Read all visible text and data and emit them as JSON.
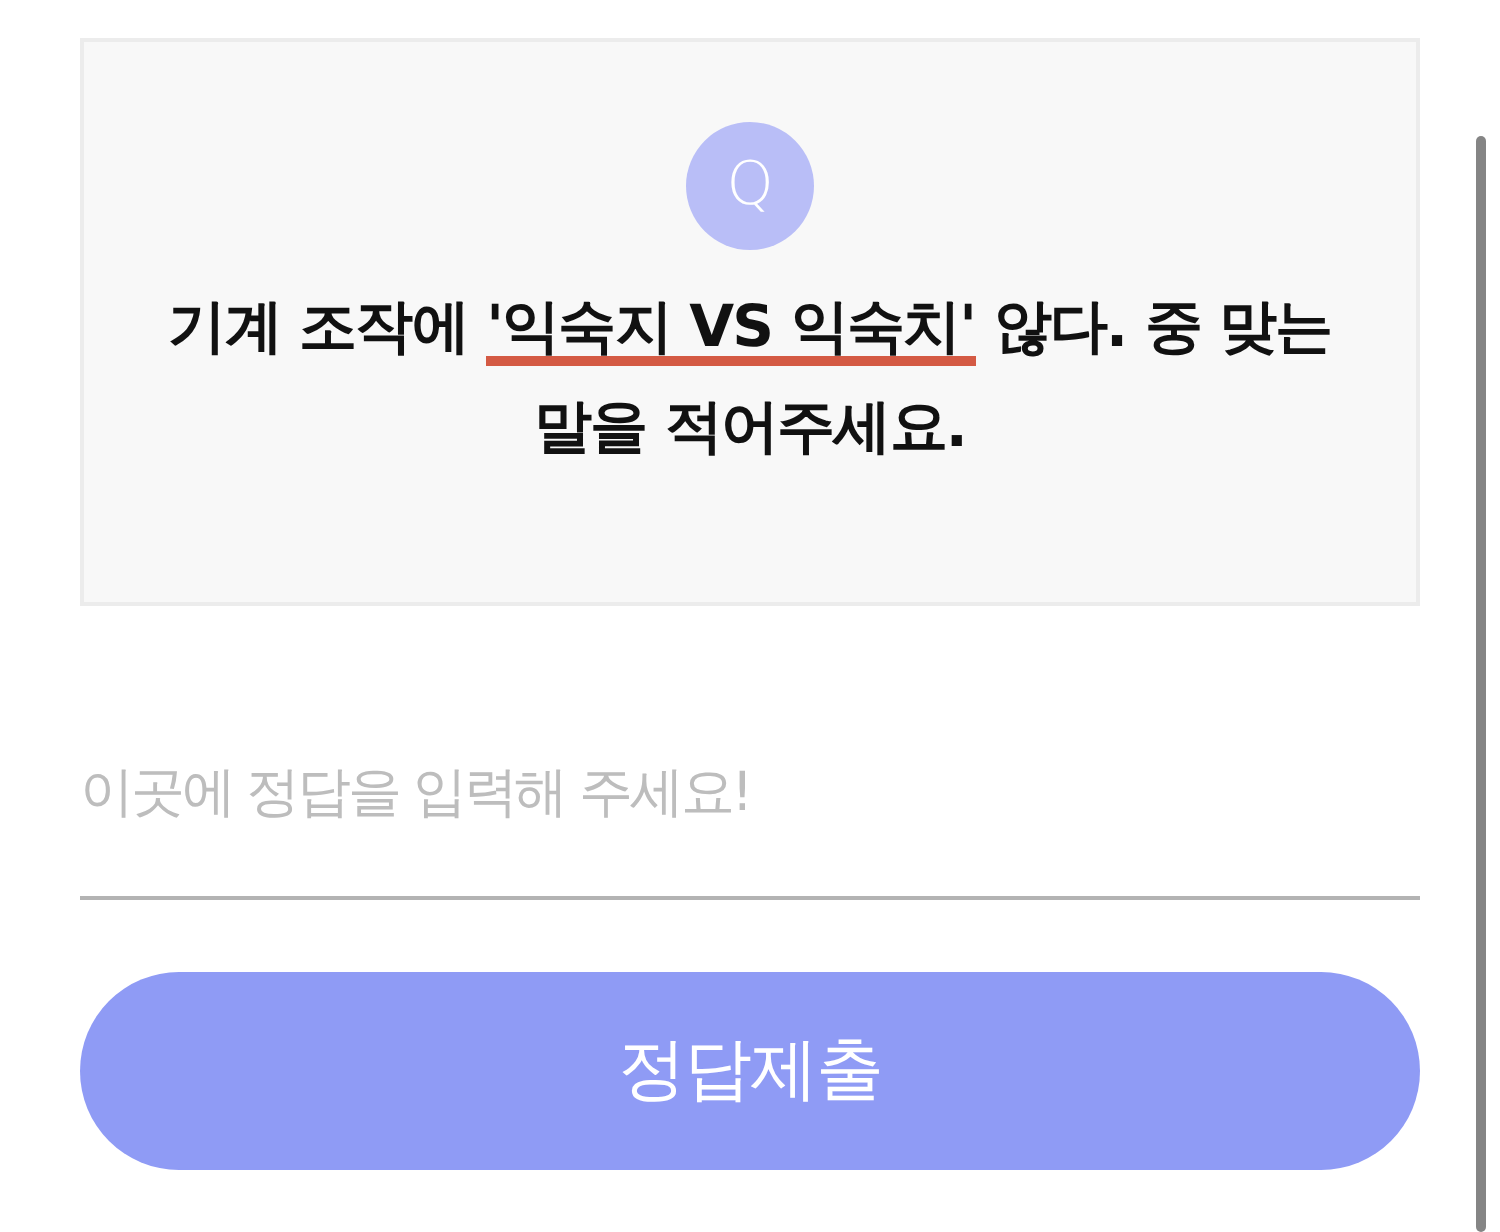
{
  "question_card": {
    "badge": "Q",
    "question": [
      {
        "text": "기계 조작에 ",
        "underlined": false
      },
      {
        "text": "'익숙지 VS 익숙치'",
        "underlined": true
      },
      {
        "text": " 않다. 중 맞는 말을 적어주세요.",
        "underlined": false
      }
    ]
  },
  "answer_field": {
    "placeholder": "이곳에 정답을 입력해 주세요!"
  },
  "submit_button": {
    "label": "정답제출"
  }
}
